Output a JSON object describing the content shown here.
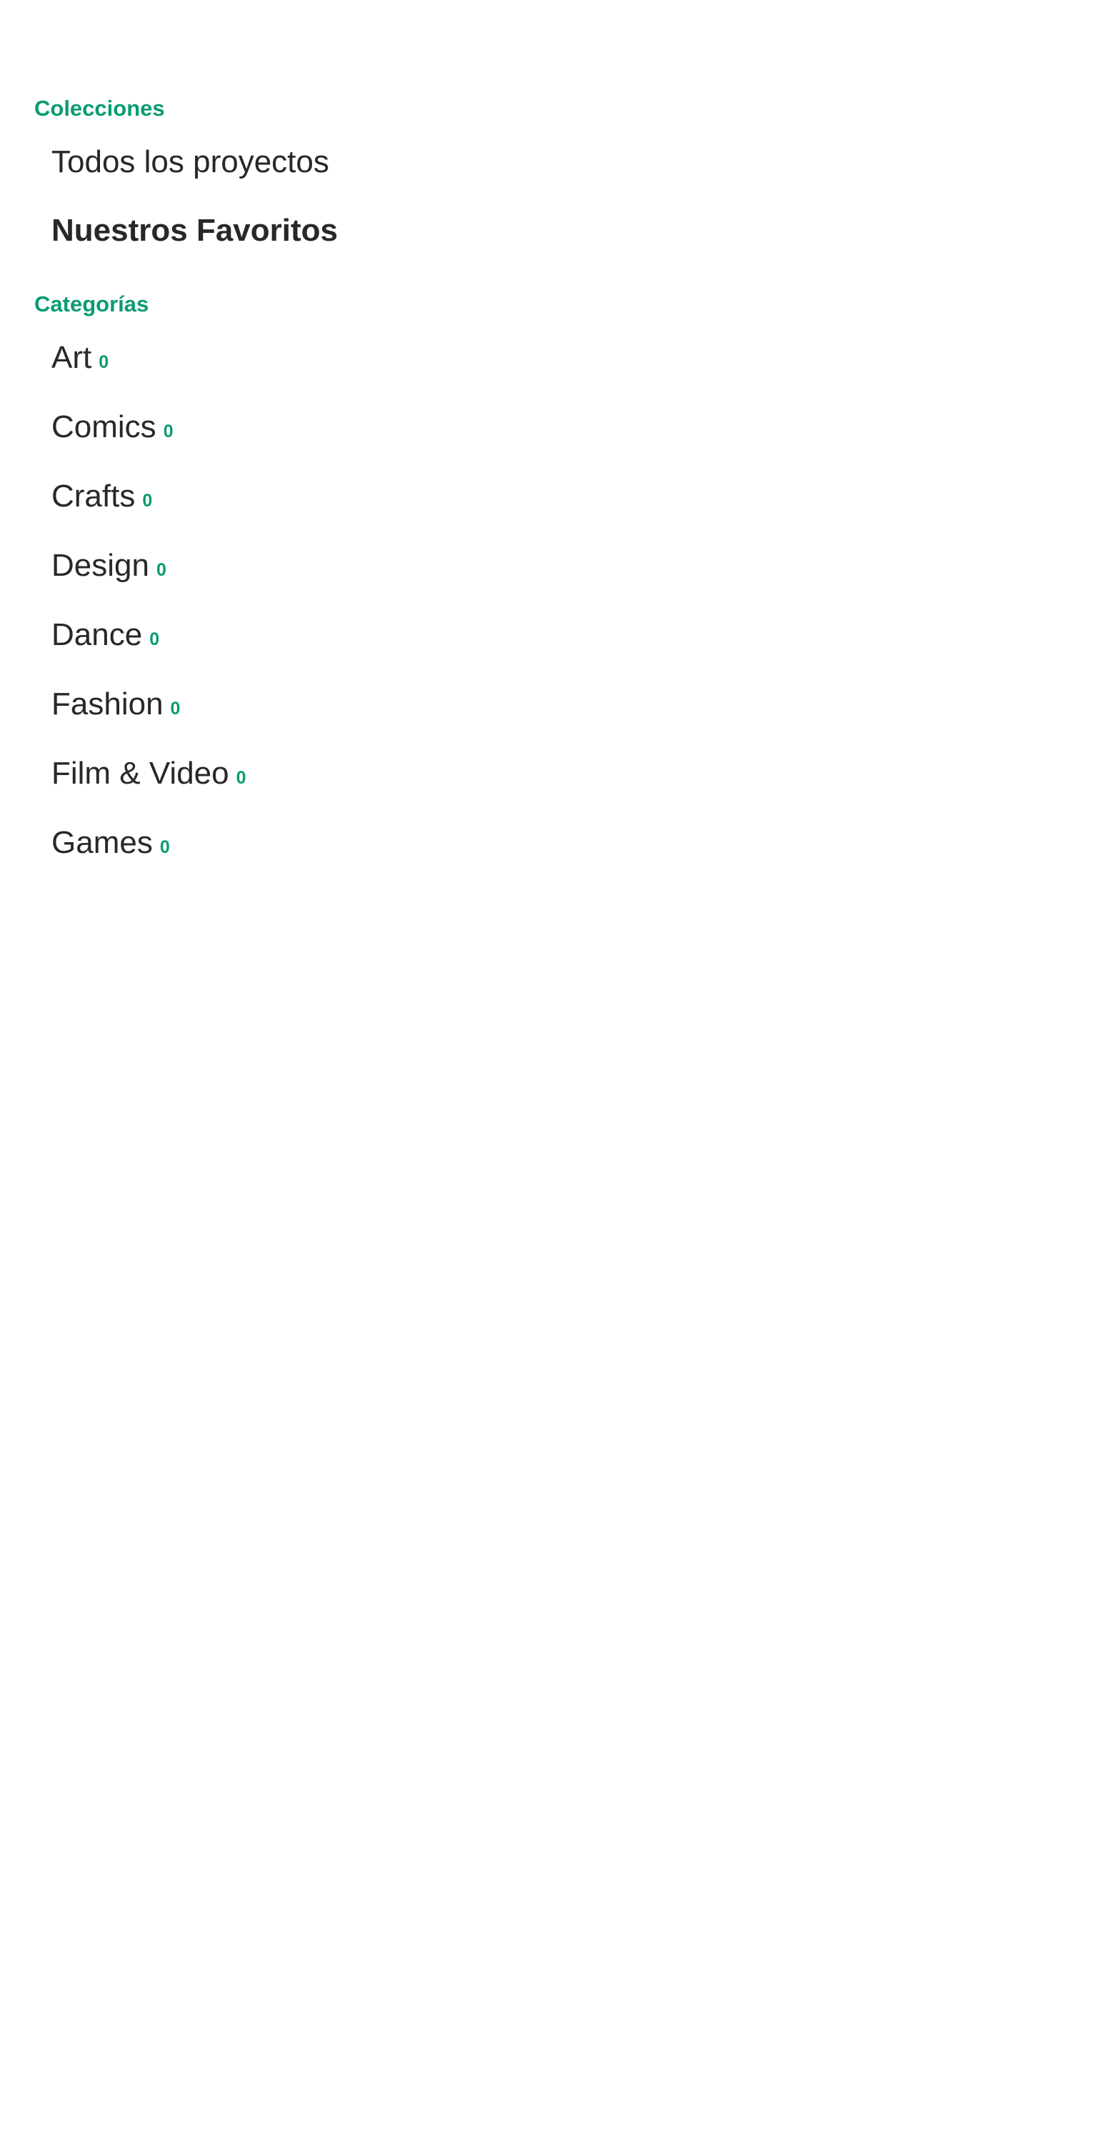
{
  "accent_color": "#0a9b72",
  "collections": {
    "heading": "Colecciones",
    "items": [
      {
        "label": "Todos los proyectos",
        "active": false
      },
      {
        "label": "Nuestros Favoritos",
        "active": true
      }
    ]
  },
  "categories": {
    "heading": "Categorías",
    "items": [
      {
        "label": "Art",
        "count": "0"
      },
      {
        "label": "Comics",
        "count": "0"
      },
      {
        "label": "Crafts",
        "count": "0"
      },
      {
        "label": "Design",
        "count": "0"
      },
      {
        "label": "Dance",
        "count": "0"
      },
      {
        "label": "Fashion",
        "count": "0"
      },
      {
        "label": "Film & Video",
        "count": "0"
      },
      {
        "label": "Games",
        "count": "0"
      }
    ]
  }
}
